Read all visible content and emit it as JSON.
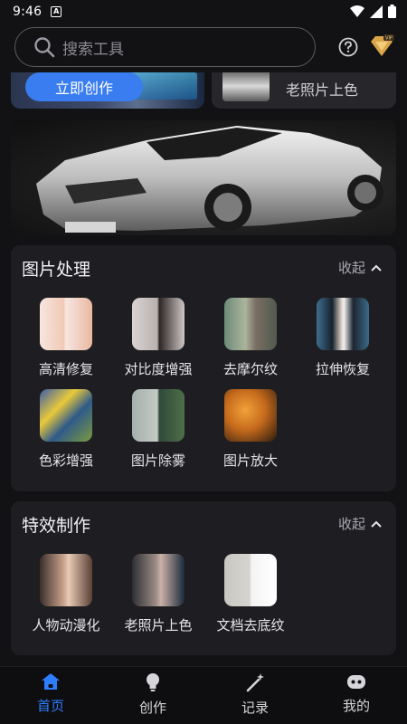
{
  "status_bar": {
    "time": "9:46",
    "notif_letter": "A"
  },
  "search": {
    "placeholder": "搜索工具"
  },
  "top_cards": {
    "create_label": "立即创作",
    "colorize_label": "老照片上色"
  },
  "sections": [
    {
      "title": "图片处理",
      "collapse_label": "收起",
      "tools": [
        {
          "label": "高清修复",
          "icon": "portrait-hd-thumb"
        },
        {
          "label": "对比度增强",
          "icon": "portrait-contrast-thumb"
        },
        {
          "label": "去摩尔纹",
          "icon": "two-women-thumb"
        },
        {
          "label": "拉伸恢复",
          "icon": "stretch-portrait-thumb"
        },
        {
          "label": "色彩增强",
          "icon": "starry-night-thumb"
        },
        {
          "label": "图片除雾",
          "icon": "foggy-landscape-thumb"
        },
        {
          "label": "图片放大",
          "icon": "tiger-thumb"
        }
      ]
    },
    {
      "title": "特效制作",
      "collapse_label": "收起",
      "tools": [
        {
          "label": "人物动漫化",
          "icon": "anime-girl-thumb"
        },
        {
          "label": "老照片上色",
          "icon": "old-photo-thumb"
        },
        {
          "label": "文档去底纹",
          "icon": "document-thumb"
        }
      ]
    }
  ],
  "bottom_nav": [
    {
      "label": "首页",
      "icon": "home-icon",
      "active": true
    },
    {
      "label": "创作",
      "icon": "lightbulb-icon",
      "active": false
    },
    {
      "label": "记录",
      "icon": "magic-wand-icon",
      "active": false
    },
    {
      "label": "我的",
      "icon": "robot-face-icon",
      "active": false
    }
  ],
  "colors": {
    "accent": "#2f7dff",
    "background": "#121214",
    "card": "#1e1e22"
  }
}
